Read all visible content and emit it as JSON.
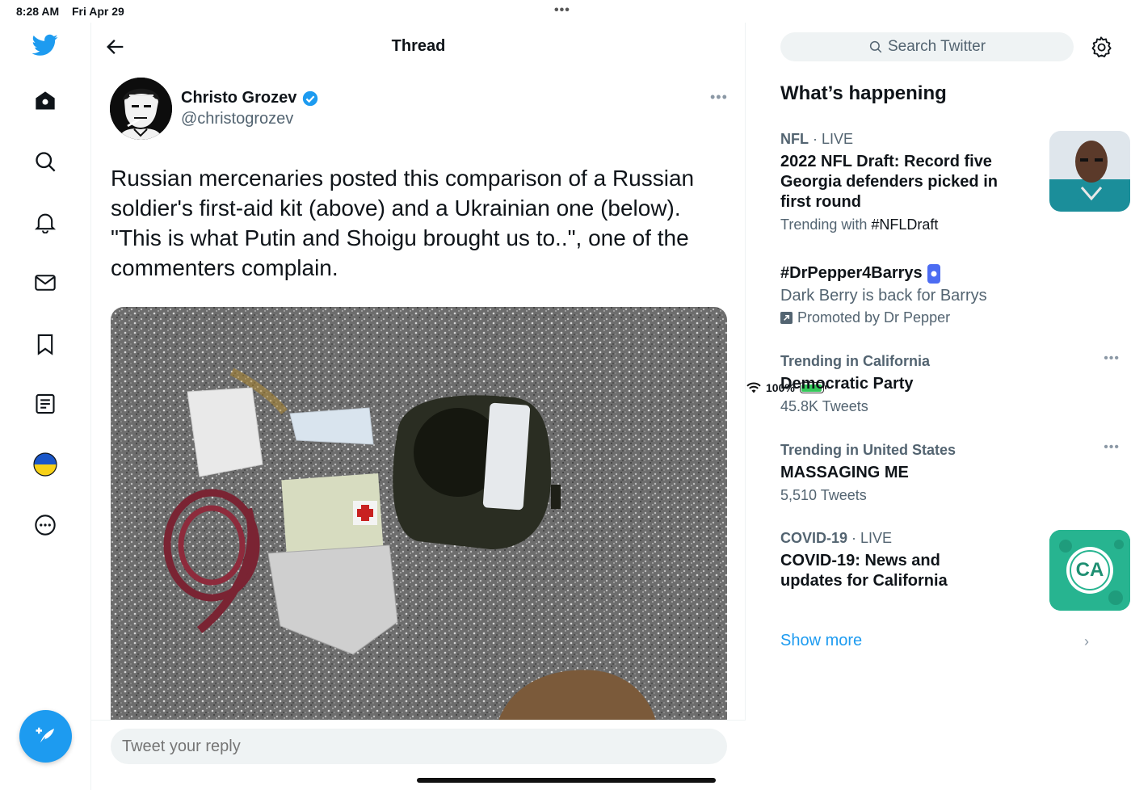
{
  "status_bar": {
    "time": "8:28 AM",
    "date": "Fri Apr 29",
    "battery": "100%"
  },
  "nav": {
    "items": [
      "twitter-logo",
      "home",
      "explore",
      "notifications",
      "messages",
      "bookmarks",
      "lists",
      "ukraine-flag",
      "more"
    ]
  },
  "thread": {
    "title": "Thread"
  },
  "tweet": {
    "author_name": "Christo Grozev",
    "handle": "@christogrozev",
    "text": "Russian mercenaries posted this comparison of a Russian soldier's first-aid kit (above) and a Ukrainian one (below). \"This is what Putin and Shoigu brought us to..\", one of the commenters complain."
  },
  "reply": {
    "placeholder": "Tweet your reply"
  },
  "sidebar": {
    "search_placeholder": "Search Twitter",
    "heading": "What’s happening",
    "trends": [
      {
        "category": "NFL",
        "live": "· LIVE",
        "title": "2022 NFL Draft: Record five Georgia defenders picked in first round",
        "sub_prefix": "Trending with",
        "sub_tag": "#NFLDraft"
      },
      {
        "title": "#DrPepper4Barrys",
        "sub": "Dark Berry is back for Barrys",
        "promoted": "Promoted by Dr Pepper"
      },
      {
        "meta": "Trending in California",
        "title": "Democratic Party",
        "sub": "45.8K Tweets"
      },
      {
        "meta": "Trending in United States",
        "title": "MASSAGING ME",
        "sub": "5,510 Tweets"
      },
      {
        "category": "COVID-19",
        "live": "· LIVE",
        "title": "COVID-19: News and updates for California",
        "thumb_text": "CA"
      }
    ],
    "show_more": "Show more"
  },
  "colors": {
    "accent": "#1d9bf0",
    "text": "#0f1419",
    "secondary": "#536471"
  }
}
